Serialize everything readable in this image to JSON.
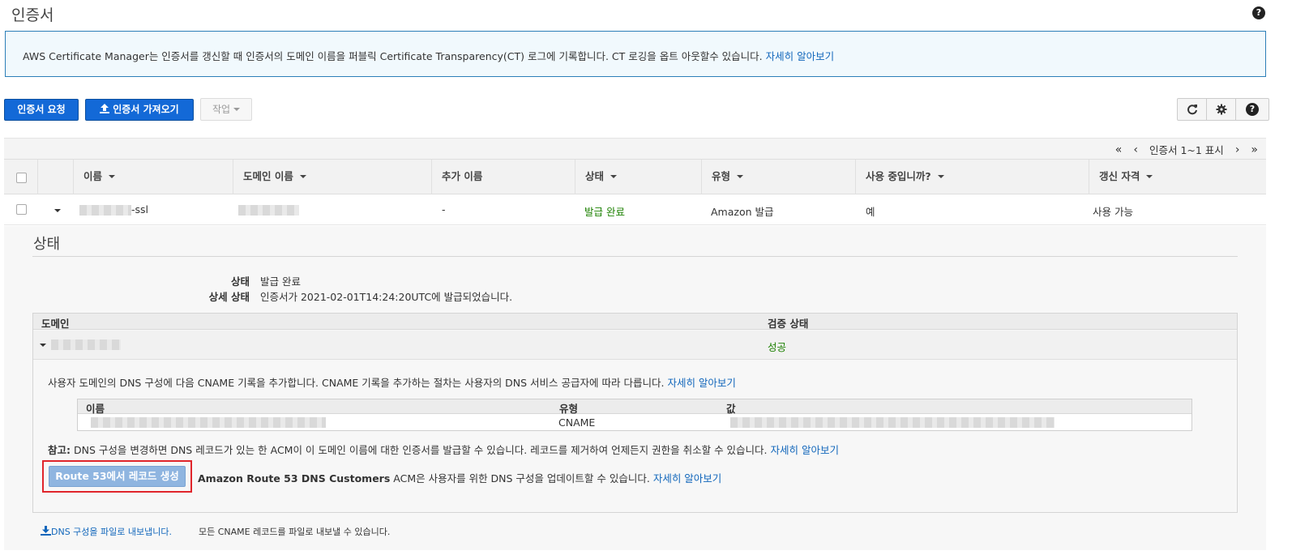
{
  "header": {
    "title": "인증서",
    "help": "?"
  },
  "banner": {
    "text": "AWS Certificate Manager는 인증서를 갱신할 때 인증서의 도메인 이름을 퍼블릭 Certificate Transparency(CT) 로그에 기록합니다. CT 로깅을 옵트 아웃할수 있습니다.",
    "link": "자세히 알아보기"
  },
  "toolbar": {
    "request_label": "인증서 요청",
    "import_label": "인증서 가져오기",
    "actions_label": "작업"
  },
  "pager": {
    "first": "«",
    "prev": "‹",
    "text": "인증서 1~1 표시",
    "next": "›",
    "last": "»"
  },
  "table": {
    "columns": [
      "이름",
      "도메인 이름",
      "추가 이름",
      "상태",
      "유형",
      "사용 중입니까?",
      "갱신 자격"
    ],
    "row": {
      "name_suffix": "-ssl",
      "additional_names": "-",
      "status": "발급 완료",
      "type": "Amazon 발급",
      "in_use": "예",
      "renewal": "사용 가능"
    }
  },
  "detail": {
    "section_title": "상태",
    "status_label": "상태",
    "status_value": "발급 완료",
    "detail_label": "상세 상태",
    "detail_value": "인증서가 2021-02-01T14:24:20UTC에 발급되었습니다.",
    "domain_col": "도메인",
    "validation_col": "검증 상태",
    "validation_value": "성공",
    "cname_instruction": "사용자 도메인의 DNS 구성에 다음 CNAME 기록을 추가합니다. CNAME 기록을 추가하는 절차는 사용자의 DNS 서비스 공급자에 따라 다릅니다.",
    "cname_instruction_link": "자세히 알아보기",
    "cname_cols": [
      "이름",
      "유형",
      "값"
    ],
    "cname_type": "CNAME",
    "note_label": "참고:",
    "note_text": "DNS 구성을 변경하면 DNS 레코드가 있는 한 ACM이 이 도메인 이름에 대한 인증서를 발급할 수 있습니다. 레코드를 제거하여 언제든지 권한을 취소할 수 있습니다.",
    "note_link": "자세히 알아보기",
    "route53_button": "Route 53에서 레코드 생성",
    "route53_bold": "Amazon Route 53 DNS Customers",
    "route53_text": "ACM은 사용자를 위한 DNS 구성을 업데이트할 수 있습니다.",
    "route53_link": "자세히 알아보기",
    "export_link": "DNS 구성을 파일로 내보냅니다.",
    "export_text": "모든 CNAME 레코드를 파일로 내보낼 수 있습니다."
  },
  "colors": {
    "primary": "#1369d7",
    "link": "#1166bb",
    "success": "#1d8102",
    "highlight": "#e0252b"
  }
}
